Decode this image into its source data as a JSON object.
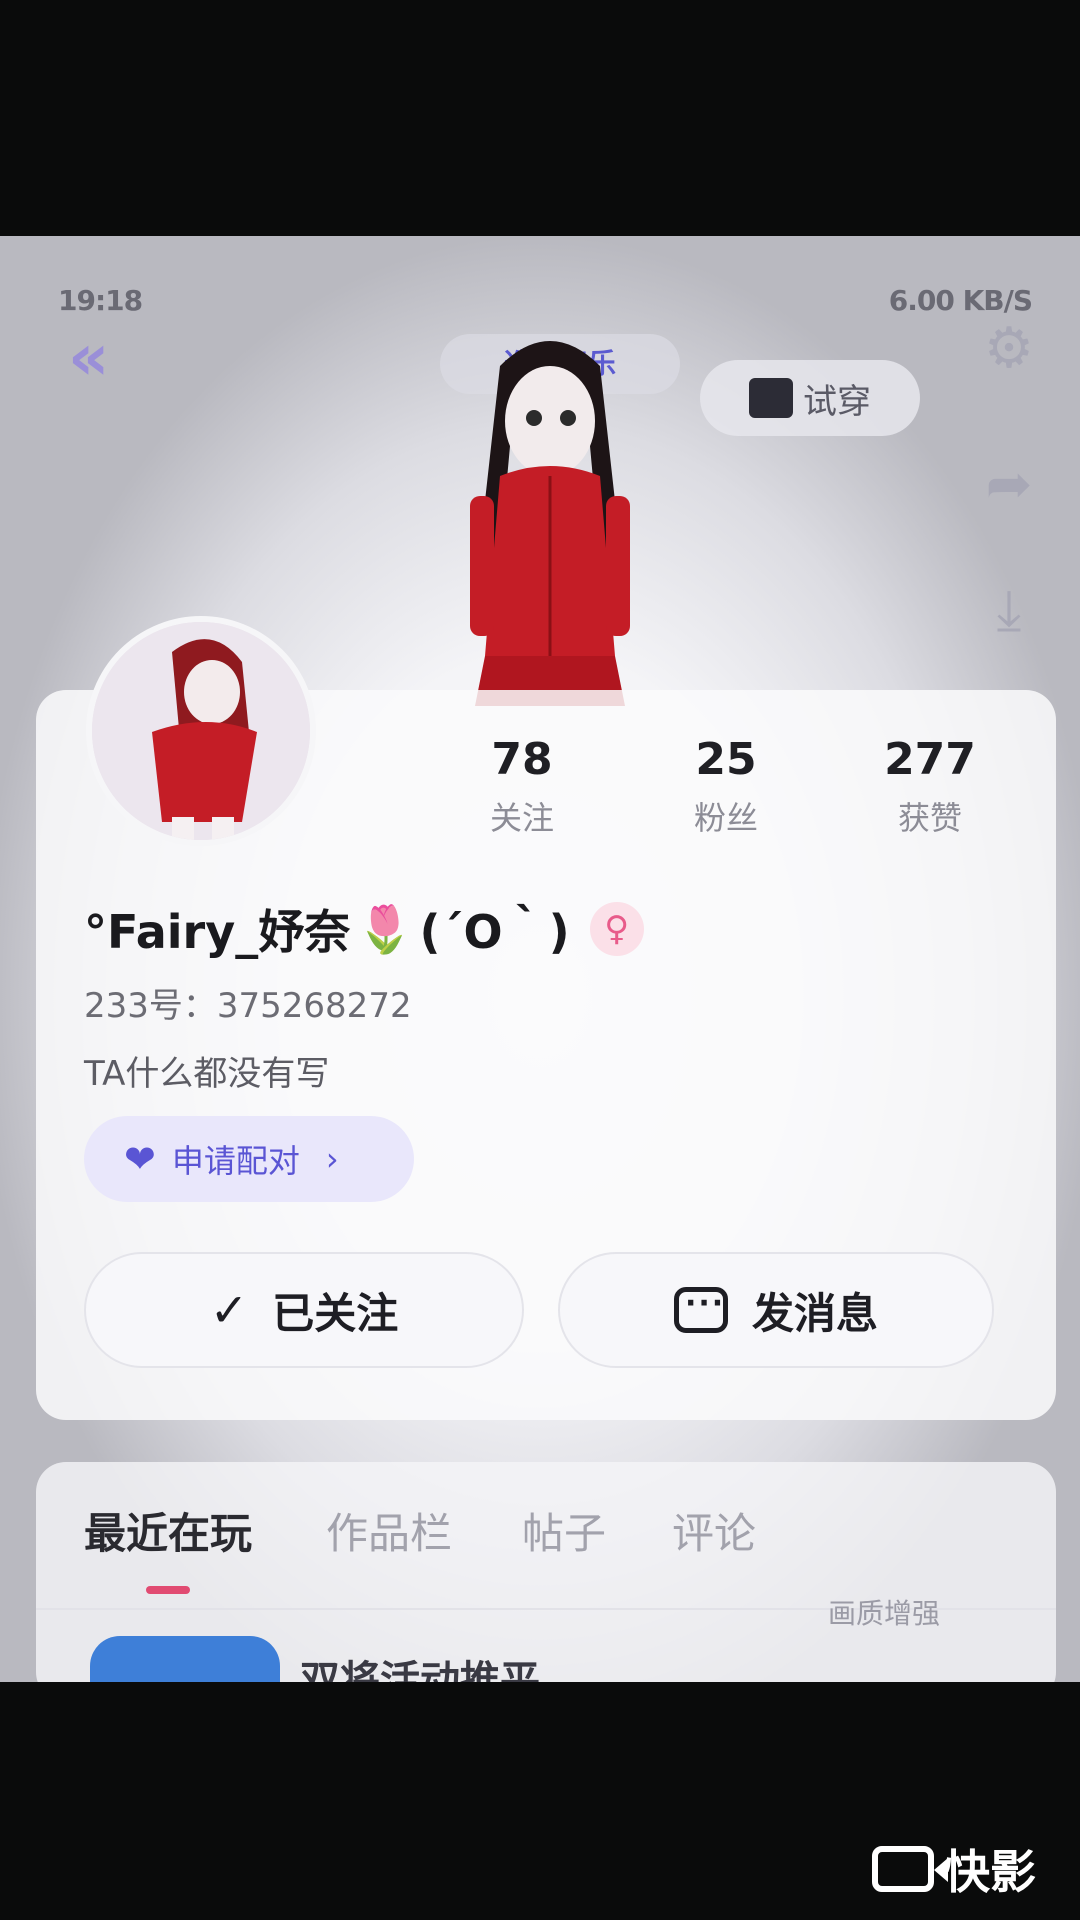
{
  "status_bar": {
    "time": "19:18",
    "right": "6.00 KB/S"
  },
  "header": {
    "music_tag": "选择音乐",
    "tryon_label": "试穿"
  },
  "profile": {
    "name": "°Fairy_妤奈",
    "emoji": "🌷",
    "kaomoji": "(´O｀)",
    "gender_symbol": "♀",
    "uid": "233号：375268272",
    "bio": "TA什么都没有写",
    "pair_label": "申请配对"
  },
  "stats": [
    {
      "value": "78",
      "label": "关注"
    },
    {
      "value": "25",
      "label": "粉丝"
    },
    {
      "value": "277",
      "label": "获赞"
    }
  ],
  "actions": {
    "follow_label": "已关注",
    "message_label": "发消息"
  },
  "tabs": [
    {
      "label": "最近在玩"
    },
    {
      "label": "作品栏"
    },
    {
      "label": "帖子"
    },
    {
      "label": "评论"
    }
  ],
  "recent_game": {
    "name": "双将活动推平"
  },
  "side_labels": {
    "quality": "画质增强"
  },
  "watermark": {
    "label": "快影"
  },
  "colors": {
    "accent": "#5a55d4",
    "tab_underline": "#e14b72",
    "gender": "#e85b8a"
  }
}
